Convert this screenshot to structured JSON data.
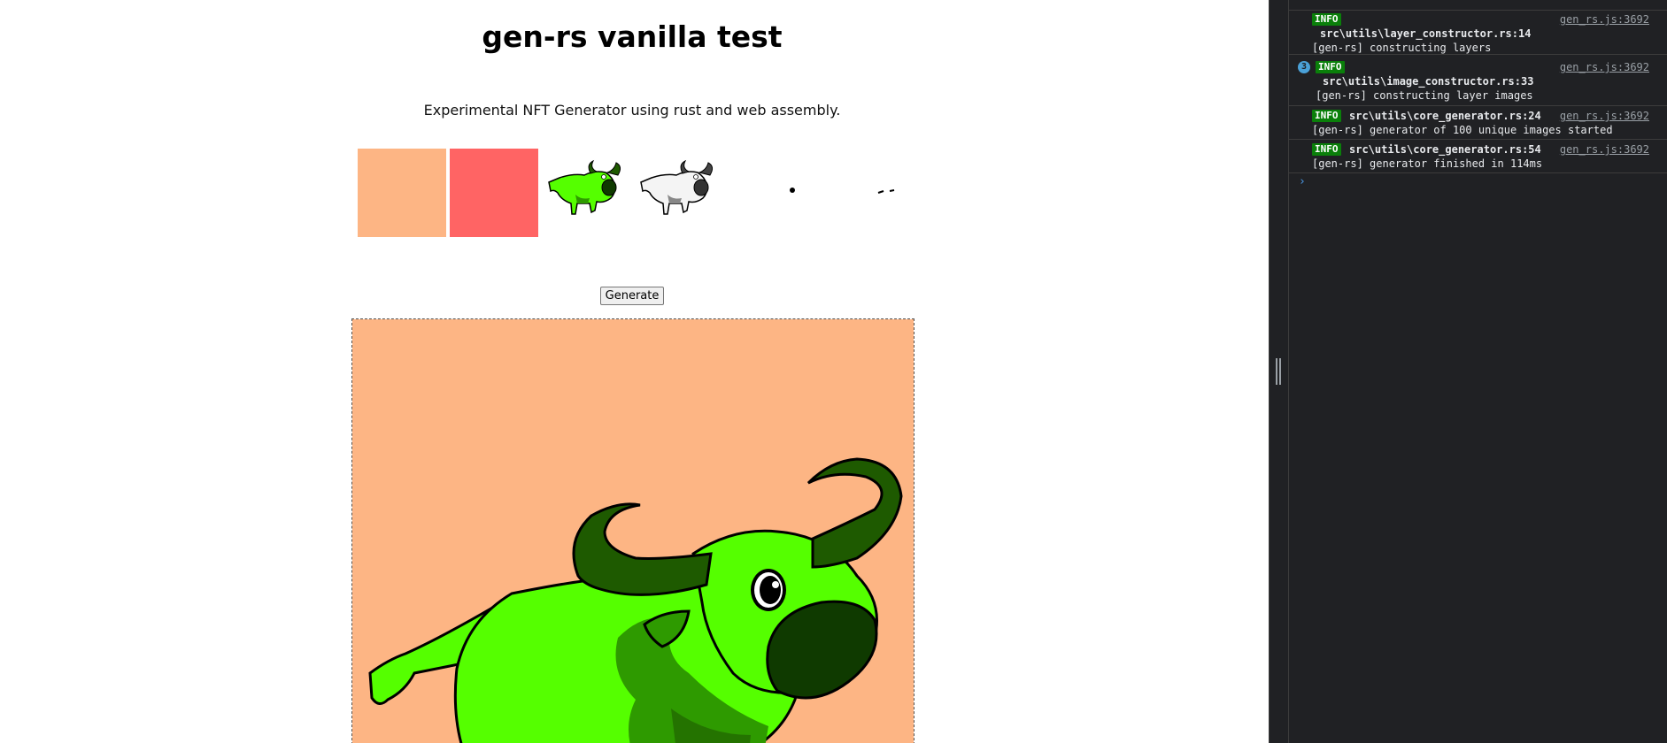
{
  "page": {
    "title": "gen-rs vanilla test",
    "subtitle": "Experimental NFT Generator using rust and web assembly.",
    "generate_label": "Generate",
    "colors": {
      "bg_layer_1": "#FDB584",
      "bg_layer_2": "#FF6464",
      "body_green": "#55FF00",
      "dark_green": "#1E5A00"
    },
    "layers": [
      {
        "name": "peach-background-layer"
      },
      {
        "name": "red-background-layer"
      },
      {
        "name": "green-bull-layer"
      },
      {
        "name": "white-bull-layer"
      },
      {
        "name": "eye-layer"
      },
      {
        "name": "eyebrows-layer"
      }
    ]
  },
  "console": {
    "messages": [
      {
        "level": "INFO",
        "source": "src\\utils\\layer_constructor.rs:14",
        "text": "[gen-rs] constructing layers",
        "link": "gen_rs.js:3692"
      },
      {
        "count": "3",
        "level": "INFO",
        "source": "src\\utils\\image_constructor.rs:33",
        "text": "[gen-rs] constructing layer images",
        "link": "gen_rs.js:3692"
      },
      {
        "level": "INFO",
        "source": "src\\utils\\core_generator.rs:24",
        "text": "[gen-rs] generator of 100 unique images started",
        "link": "gen_rs.js:3692"
      },
      {
        "level": "INFO",
        "source": "src\\utils\\core_generator.rs:54",
        "text": "[gen-rs] generator finished in 114ms",
        "link": "gen_rs.js:3692"
      }
    ],
    "prompt_glyph": "›"
  }
}
